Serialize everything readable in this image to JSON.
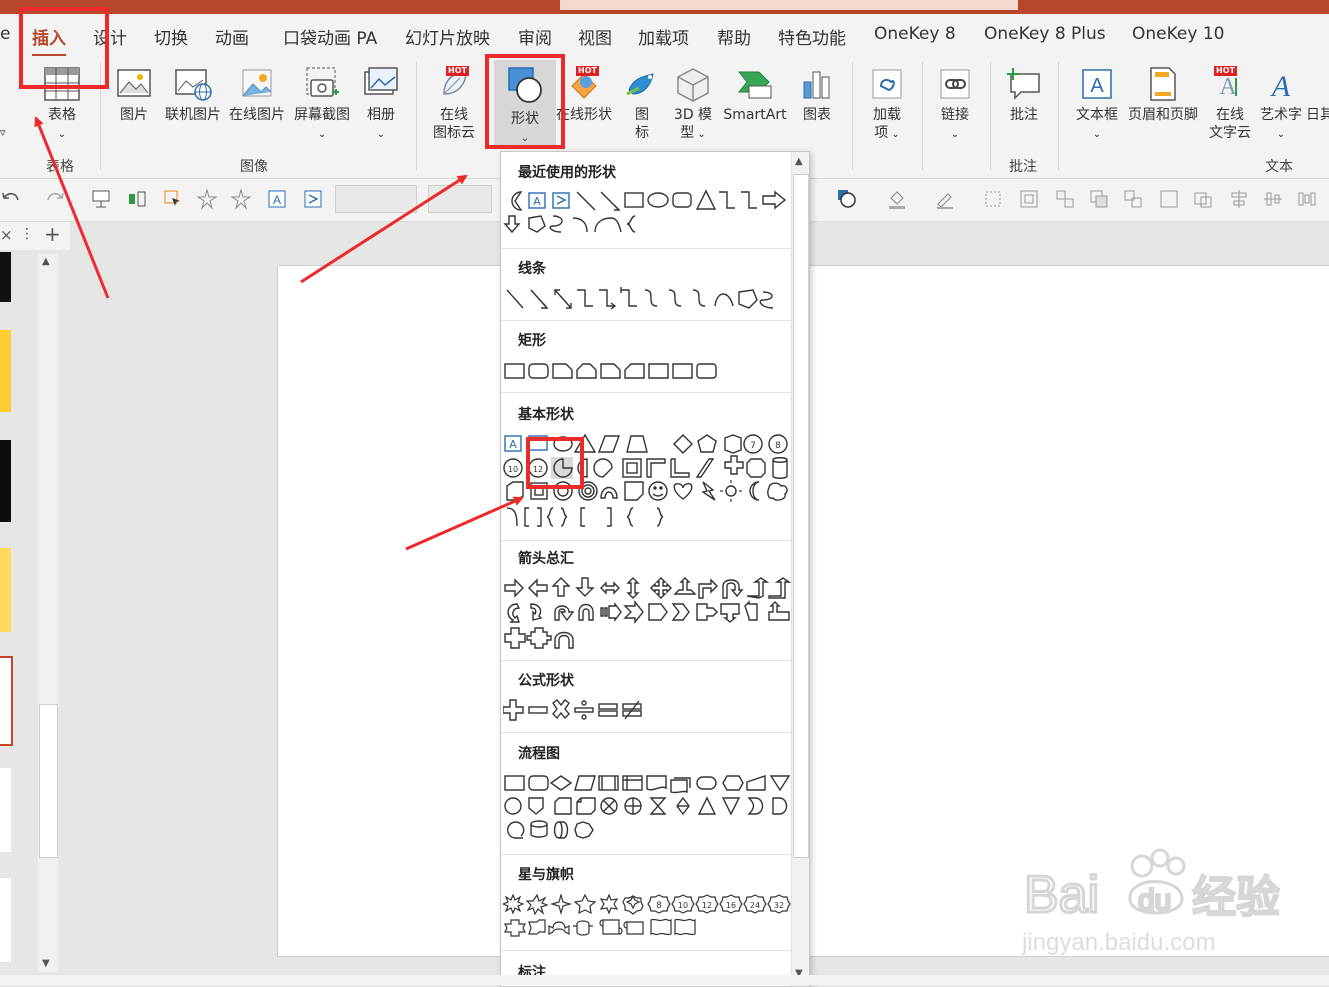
{
  "ribbon_tabs": [
    "e",
    "插入",
    "设计",
    "切换",
    "动画",
    "口袋动画 PA",
    "幻灯片放映",
    "审阅",
    "视图",
    "加载项",
    "帮助",
    "特色功能",
    "OneKey 8",
    "OneKey 8 Plus",
    "OneKey 10"
  ],
  "active_tab": "插入",
  "hot_label": "HOT",
  "ribbon": {
    "table": "表格",
    "table_group": "表格",
    "picture": "图片",
    "online_picture_linked": "联机图片",
    "online_picture": "在线图片",
    "screenshot": "屏幕截图",
    "album": "相册",
    "image_group": "图像",
    "online_icon_line1": "在线",
    "online_icon_line2": "图标云",
    "shapes": "形状",
    "online_shapes": "在线形状",
    "icons_line1": "图",
    "icons_line2": "标",
    "model3d_line1": "3D 模",
    "model3d_line2": "型",
    "smartart": "SmartArt",
    "chart": "图表",
    "addin_line1": "加载",
    "addin_line2": "项",
    "link": "链接",
    "comment": "批注",
    "comment_group": "批注",
    "textbox": "文本框",
    "header_footer": "页眉和页脚",
    "online_text_line1": "在线",
    "online_text_line2": "文字云",
    "wordart": "艺术字",
    "date_partial": "日其",
    "text_group": "文本"
  },
  "shapes_panel": {
    "sections": [
      "最近使用的形状",
      "线条",
      "矩形",
      "基本形状",
      "箭头总汇",
      "公式形状",
      "流程图",
      "星与旗帜",
      "标注"
    ]
  },
  "colors": {
    "brand": "#b7472a",
    "highlight": "#ed2a2a",
    "icon_blue": "#2b6cb0"
  }
}
